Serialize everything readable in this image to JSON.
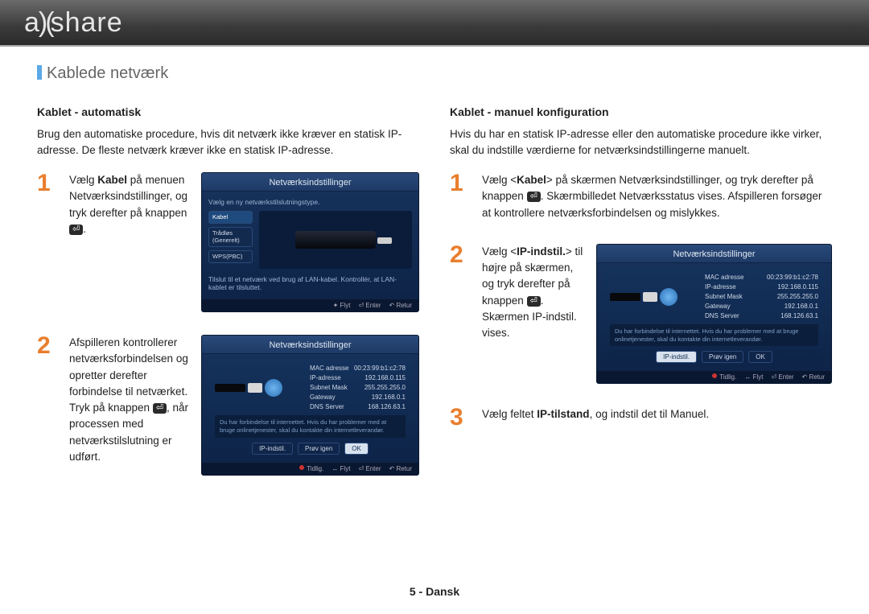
{
  "brand": "allshare",
  "section_title": "Kablede netværk",
  "footer": "5 - Dansk",
  "left": {
    "subhead": "Kablet - automatisk",
    "intro": "Brug den automatiske procedure, hvis dit netværk ikke kræver en statisk IP-adresse. De fleste netværk kræver ikke en statisk IP-adresse.",
    "steps": [
      {
        "num": "1",
        "text_pre": "Vælg ",
        "text_bold": "Kabel",
        "text_mid": " på menuen Netværksindstillinger, og tryk derefter på knappen ",
        "text_post": "."
      },
      {
        "num": "2",
        "text_pre": "Afspilleren kontrollerer netværksforbindelsen og opretter derefter forbindelse til netværket.",
        "text_br": "Tryk på knappen ",
        "text_post": ", når processen med netværkstilslutning er udført."
      }
    ]
  },
  "right": {
    "subhead": "Kablet - manuel konfiguration",
    "intro": "Hvis du har en statisk IP-adresse eller den automatiske procedure ikke virker, skal du indstille værdierne for netværksindstillingerne manuelt.",
    "steps": [
      {
        "num": "1",
        "text_pre": "Vælg <",
        "text_bold": "Kabel",
        "text_mid": "> på skærmen Netværksindstillinger, og tryk derefter på knappen ",
        "text_post": ". Skærmbilledet Netværksstatus vises. Afspilleren forsøger at kontrollere netværksforbindelsen og mislykkes."
      },
      {
        "num": "2",
        "text_pre": "Vælg <",
        "text_bold": "IP-indstil.",
        "text_mid": "> til højre på skærmen, og tryk derefter på knappen ",
        "text_post": ". Skærmen IP-indstil. vises."
      },
      {
        "num": "3",
        "text_pre": "Vælg feltet ",
        "text_bold": "IP-tilstand",
        "text_post": ", og indstil det til Manuel."
      }
    ]
  },
  "shot_common": {
    "title": "Netværksindstillinger",
    "footer_tidlig": "Tidlig.",
    "footer_flyt": "Flyt",
    "footer_enter": "Enter",
    "footer_retur": "Retur",
    "buttons": {
      "ip": "IP-indstil.",
      "retry": "Prøv igen",
      "ok": "OK"
    }
  },
  "shot_a": {
    "hint": "Vælg en ny netværkstilslutningstype.",
    "items": {
      "kabel": "Kabel",
      "wireless": "Trådløs (Generelt)",
      "wps": "WPS(PBC)"
    },
    "tip": "Tilslut til et netværk ved brug af LAN-kabel. Kontrollér, at LAN-kablet er tilsluttet."
  },
  "shot_b": {
    "kv": {
      "mac_l": "MAC adresse",
      "mac_v": "00:23:99:b1:c2:78",
      "ip_l": "IP-adresse",
      "ip_v": "192.168.0.115",
      "mask_l": "Subnet Mask",
      "mask_v": "255.255.255.0",
      "gw_l": "Gateway",
      "gw_v": "192.168.0.1",
      "dns_l": "DNS Server",
      "dns_v": "168.126.63.1"
    },
    "msg": "Du har forbindelse til internettet. Hvis du har problemer med at bruge onlinetjenester, skal du kontakte din internetleverandør."
  }
}
